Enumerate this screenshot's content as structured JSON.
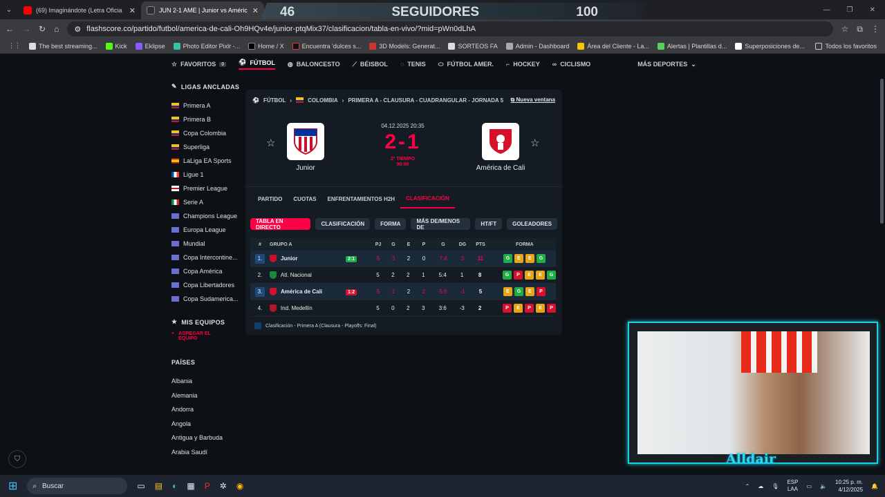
{
  "browser": {
    "tabs": [
      {
        "label": "(69) Imaginándote (Letra Oficia",
        "color": "#ff0000"
      },
      {
        "label": "JUN 2-1 AME | Junior vs Améric",
        "color": "#2b2f33"
      }
    ],
    "url": "flashscore.co/partido/futbol/america-de-cali-Oh9HQv4e/junior-ptqMix37/clasificacion/tabla-en-vivo/?mid=pWn0dLhA",
    "bookmarks": [
      "The best streaming...",
      "Kick",
      "Eklipse",
      "Photo Editor Pixlr -...",
      "Home / X",
      "Encuentra 'dulces s...",
      "3D Models: Generat...",
      "SORTEOS FA",
      "Admin - Dashboard",
      "Área del Cliente - La...",
      "Alertas | Plantillas d...",
      "Superposiciones de..."
    ],
    "bookmarks_folder": "Todos los favoritos"
  },
  "stream": {
    "left": "46",
    "label": "SEGUIDORES",
    "right": "100",
    "cam_name": "Alldair"
  },
  "nav": {
    "items": [
      "FAVORITOS",
      "FÚTBOL",
      "BALONCESTO",
      "BÉISBOL",
      "TENIS",
      "FÚTBOL AMER.",
      "HOCKEY",
      "CICLISMO"
    ],
    "fav_count": "0",
    "more": "MÁS DEPORTES"
  },
  "sidebar": {
    "pinned_title": "LIGAS ANCLADAS",
    "leagues": [
      "Primera A",
      "Primera B",
      "Copa Colombia",
      "Superliga",
      "LaLiga EA Sports",
      "Ligue 1",
      "Premier League",
      "Serie A",
      "Champions League",
      "Europa League",
      "Mundial",
      "Copa Intercontine...",
      "Copa América",
      "Copa Libertadores",
      "Copa Sudamerica..."
    ],
    "my_teams": "MIS EQUIPOS",
    "add_team": "AGREGAR EL EQUIPO",
    "countries_title": "PAÍSES",
    "countries": [
      "Albania",
      "Alemania",
      "Andorra",
      "Angola",
      "Antigua y Barbuda",
      "Arabia Saudí"
    ]
  },
  "match": {
    "breadcrumb": [
      "FÚTBOL",
      "COLOMBIA",
      "PRIMERA A - CLAUSURA - CUADRANGULAR - JORNADA 5"
    ],
    "new_window": "Nueva ventana",
    "home": "Junior",
    "away": "América de Cali",
    "date": "04.12.2025 20:35",
    "score": "2-1",
    "status": "2º TIEMPO",
    "clock": "90:00",
    "tabs": [
      "PARTIDO",
      "CUOTAS",
      "ENFRENTAMIENTOS H2H",
      "CLASIFICACIÓN"
    ],
    "filters": [
      "TABLA EN DIRECTO",
      "CLASIFICACIÓN",
      "FORMA",
      "MÁS DE/MENOS DE",
      "HT/FT",
      "GOLEADORES"
    ]
  },
  "table": {
    "headers": {
      "pos": "#",
      "group": "GRUPO A",
      "pj": "PJ",
      "g": "G",
      "e": "E",
      "p": "P",
      "goals": "G",
      "dg": "DG",
      "pts": "PTS",
      "form": "FORMA"
    },
    "rows": [
      {
        "pos": "1.",
        "team": "Junior",
        "live": "2:1",
        "pj": "5",
        "g": "3",
        "e": "2",
        "p": "0",
        "goals": "7:4",
        "dg": "3",
        "pts": "11",
        "form": [
          "G",
          "E",
          "E",
          "G"
        ]
      },
      {
        "pos": "2.",
        "team": "Atl. Nacional",
        "live": "",
        "pj": "5",
        "g": "2",
        "e": "2",
        "p": "1",
        "goals": "5:4",
        "dg": "1",
        "pts": "8",
        "form": [
          "G",
          "P",
          "E",
          "E",
          "G"
        ]
      },
      {
        "pos": "3.",
        "team": "América de Cali",
        "live": "1:2",
        "pj": "5",
        "g": "1",
        "e": "2",
        "p": "2",
        "goals": "5:6",
        "dg": "-1",
        "pts": "5",
        "form": [
          "E",
          "G",
          "E",
          "P"
        ]
      },
      {
        "pos": "4.",
        "team": "Ind. Medellín",
        "live": "",
        "pj": "5",
        "g": "0",
        "e": "2",
        "p": "3",
        "goals": "3:6",
        "dg": "-3",
        "pts": "2",
        "form": [
          "P",
          "E",
          "P",
          "E",
          "P"
        ]
      }
    ],
    "legend": "Clasificación - Primera A (Clausura - Playoffs: Final)"
  },
  "taskbar": {
    "search": "Buscar",
    "lang": "ESP",
    "lang2": "LAA",
    "time": "10:25 p. m.",
    "date": "4/12/2025"
  },
  "colors": {
    "accent": "#ff0046",
    "win": "#1fae45",
    "draw": "#e8a317",
    "loss": "#d6112b"
  }
}
